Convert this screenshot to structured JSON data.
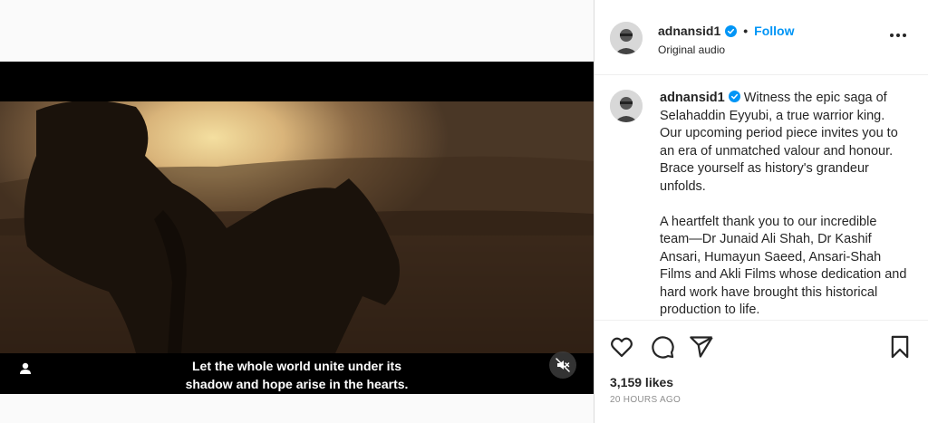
{
  "video": {
    "subtitle_line1": "Let the whole world unite under its",
    "subtitle_line2": "shadow and hope arise in the hearts.",
    "user_tag_icon": "person-icon",
    "mute_icon": "speaker-muted-icon"
  },
  "header": {
    "username": "adnansid1",
    "verified_icon": "verified-badge-icon",
    "separator": "•",
    "follow_label": "Follow",
    "audio_label": "Original audio",
    "more_icon": "more-options-icon"
  },
  "caption": {
    "username": "adnansid1",
    "paragraph1": "Witness the epic saga of Selahaddin Eyyubi, a true warrior king. Our upcoming period piece invites you to an era of unmatched valour and honour. Brace yourself as history's grandeur unfolds.",
    "paragraph2": "A heartfelt thank you to our incredible team—Dr Junaid Ali Shah, Dr Kashif Ansari, Humayun Saeed, Ansari-Shah Films and Akli Films whose dedication and hard work have brought this historical production to life."
  },
  "actions": {
    "like_icon": "heart-icon",
    "comment_icon": "comment-icon",
    "share_icon": "share-icon",
    "save_icon": "bookmark-icon"
  },
  "likes": "3,159 likes",
  "time_ago": "20 HOURS AGO",
  "colors": {
    "accent": "#0095f6",
    "verified": "#0095f6",
    "text": "#262626",
    "muted": "#8e8e8e"
  }
}
